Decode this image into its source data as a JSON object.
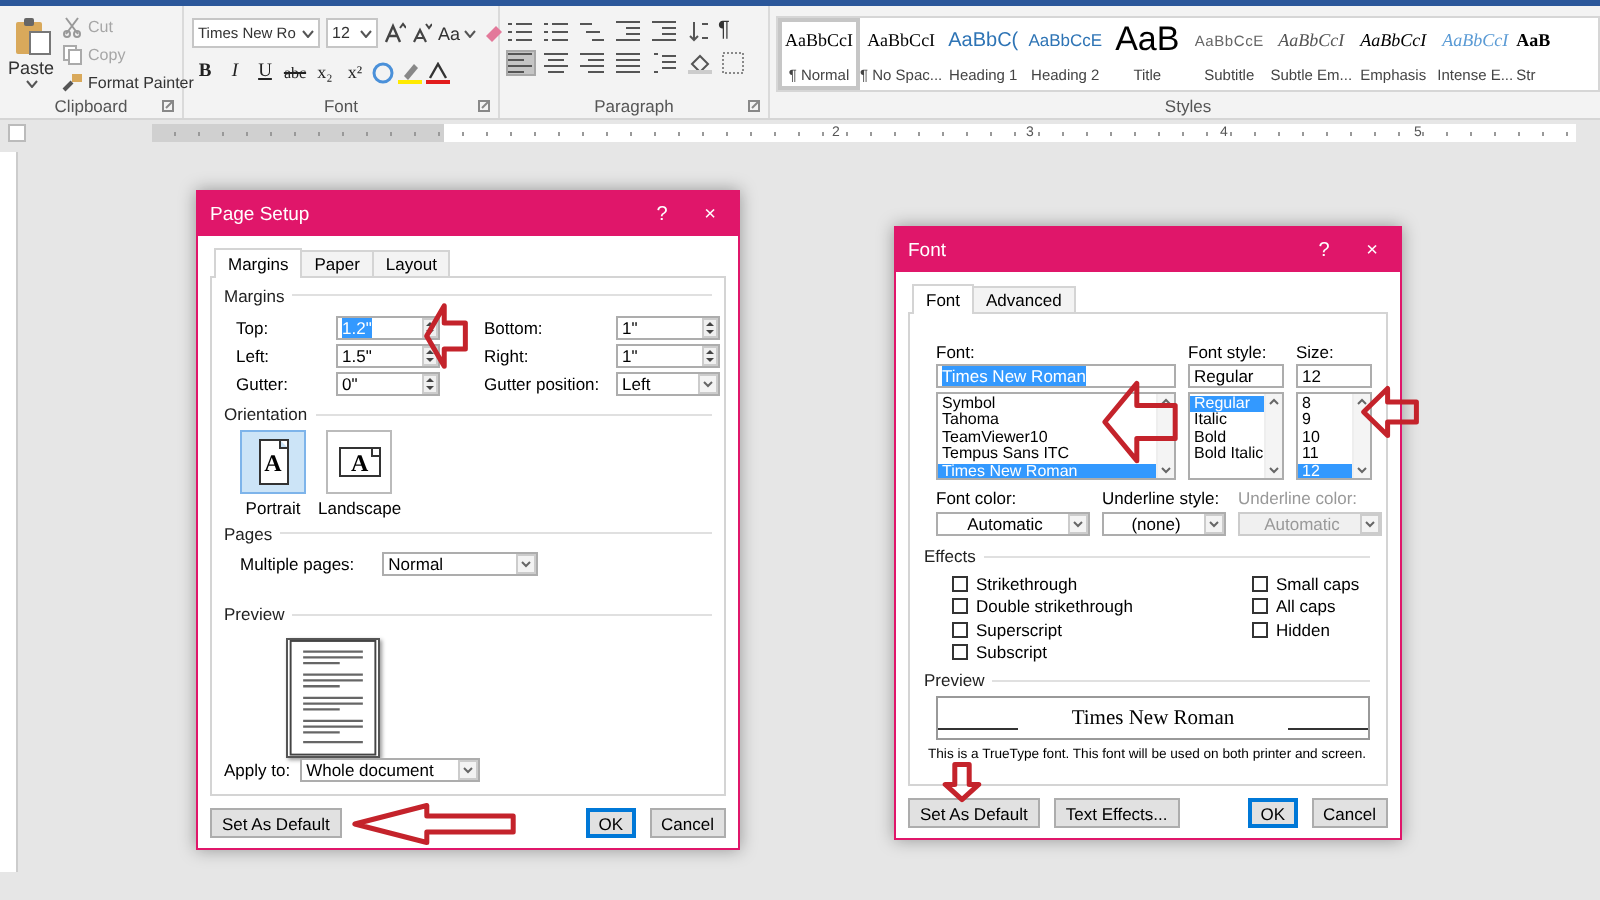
{
  "ribbon": {
    "clipboard": {
      "paste": "Paste",
      "items": [
        {
          "label": "Cut",
          "disabled": true
        },
        {
          "label": "Copy",
          "disabled": true
        },
        {
          "label": "Format Painter",
          "disabled": false
        }
      ],
      "group_label": "Clipboard"
    },
    "font": {
      "font_name": "Times New Ro",
      "font_size": "12",
      "case_button": "Aa",
      "format_buttons": [
        "B",
        "I",
        "U",
        "abc",
        "x₂",
        "x²"
      ],
      "group_label": "Font"
    },
    "paragraph": {
      "pilcrow": "¶",
      "alignment_buttons": [
        {
          "kind": "left",
          "selected": true
        },
        {
          "kind": "center",
          "selected": false
        },
        {
          "kind": "right",
          "selected": false
        },
        {
          "kind": "justify",
          "selected": false
        }
      ],
      "group_label": "Paragraph"
    },
    "styles": {
      "items": [
        {
          "preview": "AaBbCcI",
          "label": "¶ Normal",
          "kind": "normal",
          "selected": true
        },
        {
          "preview": "AaBbCcI",
          "label": "¶ No Spac...",
          "kind": "normal",
          "selected": false
        },
        {
          "preview": "AaBbC(",
          "label": "Heading 1",
          "kind": "heading1",
          "selected": false
        },
        {
          "preview": "AaBbCcE",
          "label": "Heading 2",
          "kind": "heading2",
          "selected": false
        },
        {
          "preview": "AaB",
          "label": "Title",
          "kind": "title",
          "selected": false
        },
        {
          "preview": "AaBbCcE",
          "label": "Subtitle",
          "kind": "subtitle",
          "selected": false
        },
        {
          "preview": "AaBbCcI",
          "label": "Subtle Em...",
          "kind": "subtle",
          "selected": false
        },
        {
          "preview": "AaBbCcI",
          "label": "Emphasis",
          "kind": "emphasis",
          "selected": false
        },
        {
          "preview": "AaBbCcI",
          "label": "Intense E...",
          "kind": "intense",
          "selected": false
        },
        {
          "preview": "AaB",
          "label": "Str",
          "kind": "strong",
          "selected": false
        }
      ],
      "group_label": "Styles"
    }
  },
  "ruler": {
    "labels": [
      "2",
      "3",
      "4",
      "5"
    ]
  },
  "page_setup": {
    "title": "Page Setup",
    "help": "?",
    "close": "×",
    "tabs": [
      {
        "label": "Margins",
        "selected": true
      },
      {
        "label": "Paper",
        "selected": false
      },
      {
        "label": "Layout",
        "selected": false
      }
    ],
    "margins_heading": "Margins",
    "margin_fields": [
      {
        "label": "Top:",
        "value": "1.2\"",
        "kind": "spin",
        "highlighted": true
      },
      {
        "label": "Bottom:",
        "value": "1\"",
        "kind": "spin",
        "highlighted": false
      },
      {
        "label": "Left:",
        "value": "1.5\"",
        "kind": "spin",
        "highlighted": false
      },
      {
        "label": "Right:",
        "value": "1\"",
        "kind": "spin",
        "highlighted": false
      },
      {
        "label": "Gutter:",
        "value": "0\"",
        "kind": "spin",
        "highlighted": false
      },
      {
        "label": "Gutter position:",
        "value": "Left",
        "kind": "dropdown",
        "highlighted": false
      }
    ],
    "orientation_heading": "Orientation",
    "orientations": [
      {
        "label": "Portrait",
        "glyph": "A",
        "selected": true
      },
      {
        "label": "Landscape",
        "glyph": "A",
        "selected": false
      }
    ],
    "pages_heading": "Pages",
    "multiple_pages": {
      "label": "Multiple pages:",
      "value": "Normal"
    },
    "preview_heading": "Preview",
    "apply_to": {
      "label": "Apply to:",
      "value": "Whole document"
    },
    "buttons": [
      {
        "label": "Set As Default",
        "default": false
      },
      {
        "label": "OK",
        "default": true
      },
      {
        "label": "Cancel",
        "default": false
      }
    ]
  },
  "font_dialog": {
    "title": "Font",
    "help": "?",
    "close": "×",
    "tabs": [
      {
        "label": "Font",
        "selected": true
      },
      {
        "label": "Advanced",
        "selected": false
      }
    ],
    "lists": [
      {
        "label": "Font:",
        "value": "Times New Roman",
        "highlighted": true,
        "options": [
          {
            "label": "Symbol",
            "selected": false
          },
          {
            "label": "Tahoma",
            "selected": false
          },
          {
            "label": "TeamViewer10",
            "selected": false
          },
          {
            "label": "Tempus Sans ITC",
            "selected": false
          },
          {
            "label": "Times New Roman",
            "selected": true
          }
        ]
      },
      {
        "label": "Font style:",
        "value": "Regular",
        "highlighted": false,
        "options": [
          {
            "label": "Regular",
            "selected": true
          },
          {
            "label": "Italic",
            "selected": false
          },
          {
            "label": "Bold",
            "selected": false
          },
          {
            "label": "Bold Italic",
            "selected": false
          }
        ]
      },
      {
        "label": "Size:",
        "value": "12",
        "highlighted": false,
        "options": [
          {
            "label": "8",
            "selected": false
          },
          {
            "label": "9",
            "selected": false
          },
          {
            "label": "10",
            "selected": false
          },
          {
            "label": "11",
            "selected": false
          },
          {
            "label": "12",
            "selected": true
          }
        ]
      }
    ],
    "dropdowns": [
      {
        "label": "Font color:",
        "value": "Automatic",
        "disabled": false
      },
      {
        "label": "Underline style:",
        "value": "(none)",
        "disabled": false
      },
      {
        "label": "Underline color:",
        "value": "Automatic",
        "disabled": true
      }
    ],
    "effects_heading": "Effects",
    "effects": [
      {
        "label": "Strikethrough",
        "checked": false
      },
      {
        "label": "Double strikethrough",
        "checked": false
      },
      {
        "label": "Superscript",
        "checked": false
      },
      {
        "label": "Subscript",
        "checked": false
      },
      {
        "label": "Small caps",
        "checked": false
      },
      {
        "label": "All caps",
        "checked": false
      },
      {
        "label": "Hidden",
        "checked": false
      }
    ],
    "preview_heading": "Preview",
    "preview_text": "Times New Roman",
    "note": "This is a TrueType font. This font will be used on both printer and screen.",
    "buttons": [
      {
        "label": "Set As Default",
        "default": false
      },
      {
        "label": "Text Effects...",
        "default": false
      },
      {
        "label": "OK",
        "default": true
      },
      {
        "label": "Cancel",
        "default": false
      }
    ]
  },
  "annotations": [
    {
      "kind": "left"
    },
    {
      "kind": "left"
    },
    {
      "kind": "left"
    },
    {
      "kind": "left"
    },
    {
      "kind": "down"
    }
  ]
}
